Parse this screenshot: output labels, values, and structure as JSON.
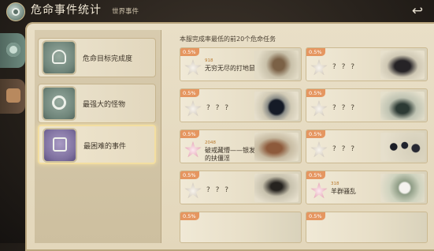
{
  "header": {
    "title": "危命事件统计",
    "subtitle": "世界事件",
    "back_icon": "return-arrow-icon"
  },
  "side_tabs": [
    {
      "icon": "eye-orb-icon"
    },
    {
      "icon": "book-icon"
    }
  ],
  "menu": [
    {
      "label": "危命目标完成度",
      "icon": "target-crest-icon",
      "selected": false
    },
    {
      "label": "最强大的怪物",
      "icon": "horned-skull-icon",
      "selected": false
    },
    {
      "label": "最困难的事件",
      "icon": "open-book-icon",
      "selected": true
    }
  ],
  "list": {
    "title": "本服完成率最低的前20个危命任务",
    "tasks": [
      {
        "pct": "0.5%",
        "num": "918",
        "name": "无穷无尽的打地鼠",
        "art": "rat"
      },
      {
        "pct": "0.5%",
        "num": "",
        "name": "? ? ?",
        "art": "wolf"
      },
      {
        "pct": "0.5%",
        "num": "",
        "name": "? ? ?",
        "art": "orb"
      },
      {
        "pct": "0.5%",
        "num": "",
        "name": "? ? ?",
        "art": "spider"
      },
      {
        "pct": "0.5%",
        "num": "2048",
        "name": "破戒藏懵——银发的扶僵淫",
        "art": "beast"
      },
      {
        "pct": "0.5%",
        "num": "",
        "name": "? ? ?",
        "art": "balls"
      },
      {
        "pct": "0.5%",
        "num": "",
        "name": "? ? ?",
        "art": "spider2"
      },
      {
        "pct": "0.5%",
        "num": "318",
        "name": "羊群骚乱",
        "art": "sheep"
      }
    ]
  },
  "colors": {
    "badge_orange": "#e59660",
    "parchment": "#e6dbc1",
    "highlight": "#f3dea0"
  }
}
